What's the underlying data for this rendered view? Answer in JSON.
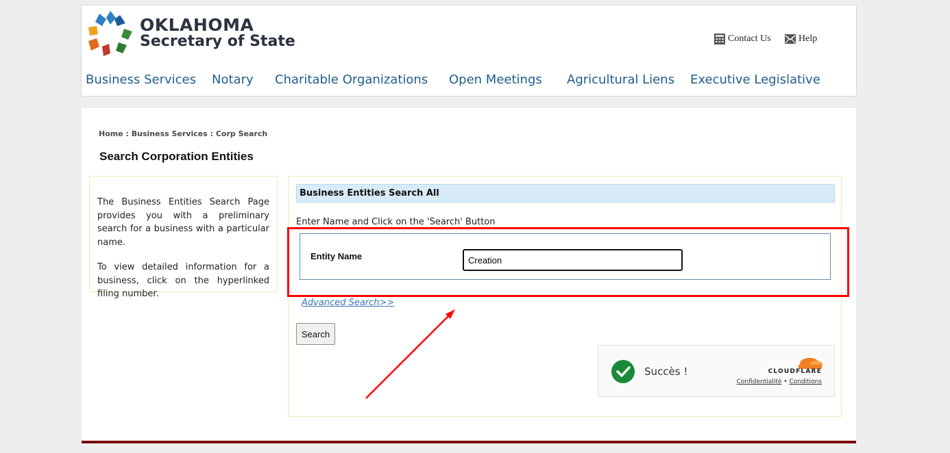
{
  "header": {
    "logo_title": "OKLAHOMA",
    "logo_subtitle": "Secretary of State",
    "contact_label": "Contact Us",
    "help_label": "Help",
    "nav": [
      "Business Services",
      "Notary",
      "Charitable Organizations",
      "Open Meetings",
      "Agricultural Liens",
      "Executive Legislative"
    ]
  },
  "breadcrumb": {
    "home": "Home",
    "business_services": "Business Services",
    "current": "Corp Search",
    "separator": " : "
  },
  "page_title": "Search Corporation Entities",
  "info": {
    "para1": "The Business Entities Search Page provides you with a preliminary search for a business with a particular name.",
    "para2": "To view detailed information for a business, click on the hyperlinked filing number."
  },
  "search": {
    "header": "Business Entities Search All",
    "instruction": "Enter Name and Click on the 'Search' Button",
    "entity_label": "Entity Name",
    "entity_value": "Creation",
    "advanced_link": "Advanced Search>>",
    "search_button": "Search"
  },
  "captcha": {
    "status": "Succès !",
    "brand": "CLOUDFLARE",
    "privacy": "Confidentialité",
    "dot": " • ",
    "terms": "Conditions"
  },
  "colors": {
    "nav_link": "#1f5d8f",
    "annotation": "#ff0000",
    "captcha_success": "#1a8a3a",
    "cloudflare_orange": "#f38020",
    "footer_bar": "#7a0a0a"
  },
  "icons": [
    "logo-star-icon",
    "contact-icon",
    "help-envelope-icon",
    "checkmark-icon",
    "cloudflare-cloud-icon"
  ]
}
